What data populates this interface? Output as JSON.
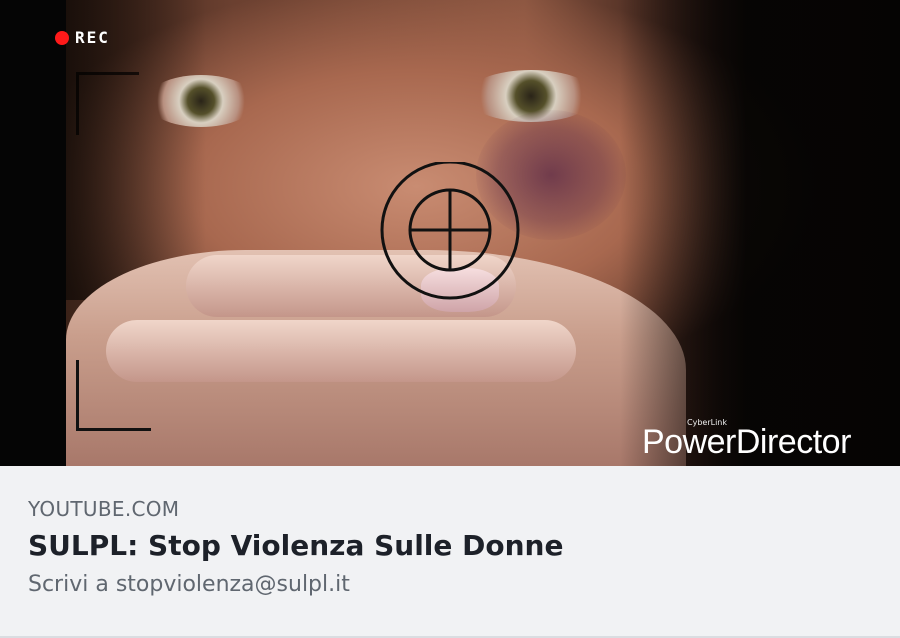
{
  "thumbnail": {
    "rec_label": "REC",
    "watermark_small": "CyberLink",
    "watermark_brand": "PowerDirector",
    "rec_color": "#ff1a1a"
  },
  "link": {
    "domain": "YOUTUBE.COM",
    "title": "SULPL: Stop Violenza Sulle Donne",
    "description": "Scrivi a stopviolenza@sulpl.it"
  },
  "colors": {
    "panel_bg": "#f1f2f4",
    "title_text": "#1d2129",
    "secondary_text": "#606770"
  }
}
